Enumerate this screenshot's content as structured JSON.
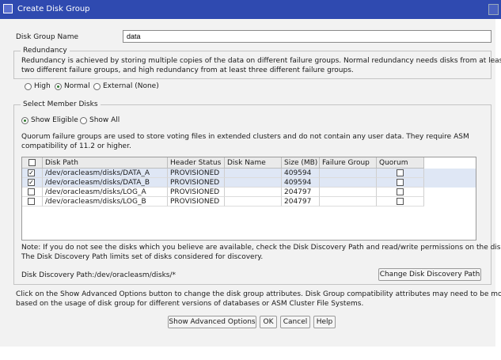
{
  "window": {
    "title": "Create Disk Group"
  },
  "disk_group_name": {
    "label": "Disk Group Name",
    "value": "data"
  },
  "redundancy": {
    "legend": "Redundancy",
    "description_line1": "Redundancy is achieved by storing multiple copies of the data on different failure groups. Normal redundancy needs disks from at least",
    "description_line2": "two different failure groups, and high redundancy from at least three different failure groups.",
    "options": [
      "High",
      "Normal",
      "External (None)"
    ],
    "selected": "Normal"
  },
  "member_disks": {
    "legend": "Select Member Disks",
    "filter_options": [
      "Show Eligible",
      "Show All"
    ],
    "filter_selected": "Show Eligible",
    "quorum_note_line1": "Quorum failure groups are used to store voting files in extended clusters and do not contain any user data. They require ASM",
    "quorum_note_line2": "compatibility of 11.2 or higher.",
    "columns": [
      "",
      "Disk Path",
      "Header Status",
      "Disk Name",
      "Size (MB)",
      "Failure Group",
      "Quorum"
    ],
    "rows": [
      {
        "checked": true,
        "path": "/dev/oracleasm/disks/DATA_A",
        "status": "PROVISIONED",
        "name": "",
        "size": "409594",
        "failure_group": "",
        "quorum": false
      },
      {
        "checked": true,
        "path": "/dev/oracleasm/disks/DATA_B",
        "status": "PROVISIONED",
        "name": "",
        "size": "409594",
        "failure_group": "",
        "quorum": false
      },
      {
        "checked": false,
        "path": "/dev/oracleasm/disks/LOG_A",
        "status": "PROVISIONED",
        "name": "",
        "size": "204797",
        "failure_group": "",
        "quorum": false
      },
      {
        "checked": false,
        "path": "/dev/oracleasm/disks/LOG_B",
        "status": "PROVISIONED",
        "name": "",
        "size": "204797",
        "failure_group": "",
        "quorum": false
      }
    ],
    "note_line1": "Note: If you do not see the disks which you believe are available, check the Disk Discovery Path and read/write permissions on the disks.",
    "note_line2": "The Disk Discovery Path limits set of disks considered for discovery.",
    "discovery_path_label": "Disk Discovery Path:",
    "discovery_path_value": "/dev/oracleasm/disks/*",
    "change_path_button": "Change Disk Discovery Path"
  },
  "advanced": {
    "text_line1": "Click on the Show Advanced Options button to change the disk group attributes. Disk Group compatibility attributes may need to be modified",
    "text_line2": "based on the usage of disk group for different versions of databases or ASM Cluster File Systems."
  },
  "buttons": {
    "advanced": "Show Advanced Options",
    "ok": "OK",
    "cancel": "Cancel",
    "help": "Help"
  }
}
